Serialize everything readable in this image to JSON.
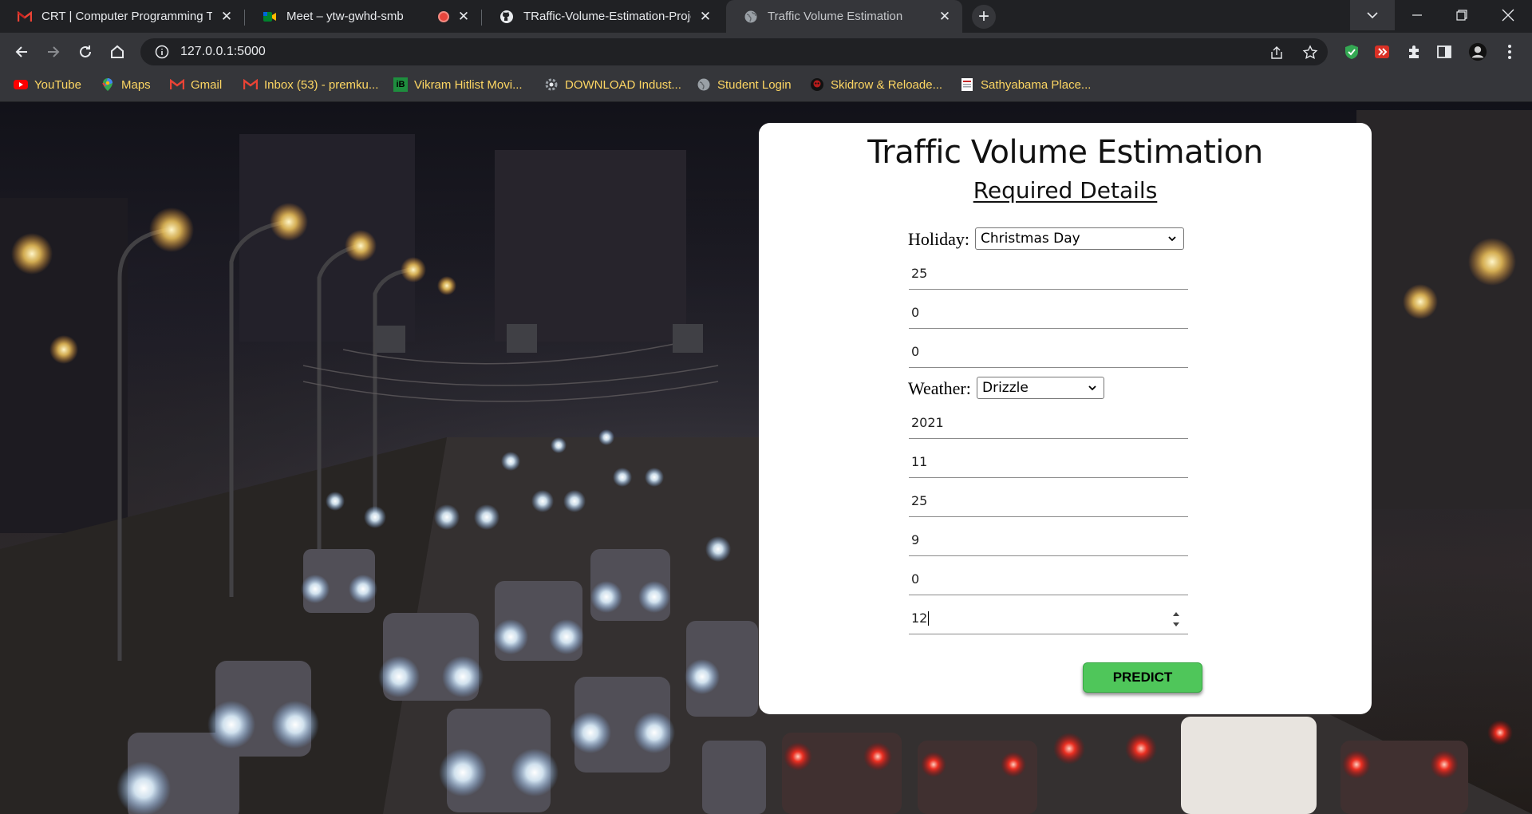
{
  "browser": {
    "tabs": [
      {
        "title": "CRT | Computer Programming Tr",
        "icon": "gmail-icon",
        "active": false
      },
      {
        "title": "Meet – ytw-gwhd-smb",
        "icon": "google-meet-icon",
        "active": false,
        "recording": true
      },
      {
        "title": "TRaffic-Volume-Estimation-Proje",
        "icon": "github-icon",
        "active": false
      },
      {
        "title": "Traffic Volume Estimation",
        "icon": "globe-icon",
        "active": true
      }
    ],
    "new_tab": "+",
    "url": "127.0.0.1:5000",
    "bookmarks": [
      {
        "label": "YouTube",
        "icon": "youtube-icon"
      },
      {
        "label": "Maps",
        "icon": "maps-icon"
      },
      {
        "label": "Gmail",
        "icon": "gmail-icon"
      },
      {
        "label": "Inbox (53) - premku...",
        "icon": "gmail-icon"
      },
      {
        "label": "Vikram Hitlist Movi...",
        "icon": "ib-icon"
      },
      {
        "label": "DOWNLOAD Indust...",
        "icon": "gear-icon"
      },
      {
        "label": "Student Login",
        "icon": "globe-icon"
      },
      {
        "label": "Skidrow & Reloade...",
        "icon": "skull-icon"
      },
      {
        "label": "Sathyabama Place...",
        "icon": "doc-icon"
      }
    ],
    "bookmark_color": "#fdd663"
  },
  "form": {
    "title": "Traffic Volume Estimation",
    "subtitle": "Required Details",
    "holiday_label": "Holiday:",
    "holiday_value": "Christmas Day",
    "fields_a": [
      "25",
      "0",
      "0"
    ],
    "weather_label": "Weather:",
    "weather_value": "Drizzle",
    "fields_b": [
      "2021",
      "11",
      "25",
      "9",
      "0",
      "12"
    ],
    "predict_label": "PREDICT",
    "predict_color": "#4fc65a"
  }
}
